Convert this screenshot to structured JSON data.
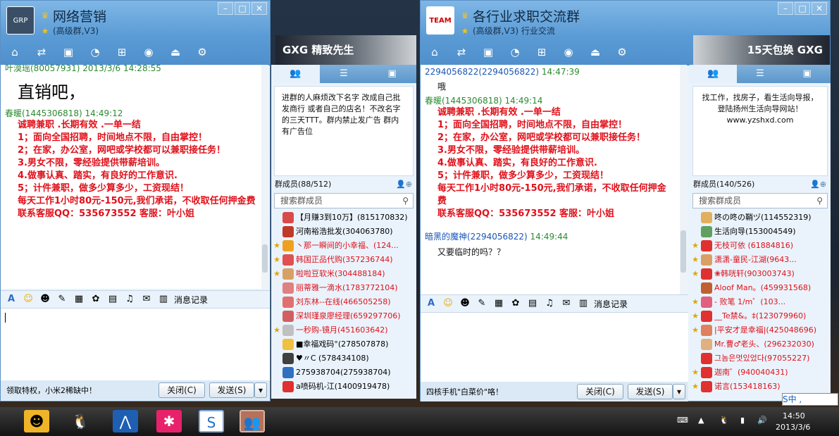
{
  "common": {
    "history": "消息记录",
    "close": "关闭(C)",
    "send": "发送(S)",
    "search": "搜索群成员"
  },
  "ime": "S中 ,",
  "win1": {
    "title": "网络营销",
    "subtitle": "(高级群,V3)",
    "banner": "GXG 精致先生",
    "tip": "领取特权，小米2稀缺中！",
    "notice": "进群的人麻烦改下名字 改成自己批发商行 或者自己的店名！不改名字的三天TTT。群内禁止发广告 群内有广告位",
    "members_label": "群成员(88/512)",
    "msgs": [
      {
        "sender": "叶漠瑶(80057931)",
        "time": "2013/3/6 14:28:55",
        "text": "直销吧，"
      },
      {
        "sender": "春暖(1445306818)",
        "time": "14:49:12",
        "text": ""
      }
    ],
    "ad_lines": [
      "诚聘兼职 .长期有效 .一单一结",
      "1；面向全国招聘，时间地点不限，自由掌控！",
      "2；在家，办公室，网吧或学校都可以兼职接任务！",
      "3.男女不限，零经验提供带薪培训。",
      "4.做事认真、踏实，有良好的工作意识.",
      "5；计件兼职，做多少算多少，工资现结！",
      "每天工作1小时80元-150元,我们承诺，不收取任何押金费",
      "联系客服QQ：535673552  客服：叶小姐"
    ],
    "members": [
      {
        "name": "【月赚3到10万】(815170832)",
        "red": false,
        "crown": false,
        "color": "#d94a4a"
      },
      {
        "name": "河南裕浩批发(304063780)",
        "red": false,
        "crown": false,
        "color": "#c0392b"
      },
      {
        "name": "丶那一瞬间的小幸福、(124...",
        "red": true,
        "crown": true,
        "color": "#f0a020"
      },
      {
        "name": "韩国正品代购(357236744)",
        "red": true,
        "crown": true,
        "color": "#e05050"
      },
      {
        "name": "啦啦豆软米(304488184)",
        "red": true,
        "crown": true,
        "color": "#d9a066"
      },
      {
        "name": "丽蒂雅一滴水(1783772104)",
        "red": true,
        "crown": false,
        "color": "#e08080"
      },
      {
        "name": "刘东林--在线(466505258)",
        "red": true,
        "crown": false,
        "color": "#e07070"
      },
      {
        "name": "深圳瑾泉廖经理(659297706)",
        "red": true,
        "crown": false,
        "color": "#d06060"
      },
      {
        "name": "一秒购-镜月(451603642)",
        "red": true,
        "crown": true,
        "color": "#c0c0c0"
      },
      {
        "name": "■幸福戏码°(278507878)",
        "red": false,
        "crown": false,
        "color": "#f0c040"
      },
      {
        "name": "♥〃C (578434108)",
        "red": false,
        "crown": false,
        "color": "#404040"
      },
      {
        "name": "275938704(275938704)",
        "red": false,
        "crown": false,
        "color": "#3070c0"
      },
      {
        "name": "a喷码机-江(1400919478)",
        "red": false,
        "crown": false,
        "color": "#e03030"
      }
    ]
  },
  "win2": {
    "title": "各行业求职交流群",
    "subtitle": "(高级群,V3) 行业交流",
    "banner": "15天包换 GXG",
    "tip": "四核手机\"白菜价\"咯！",
    "notice": "找工作，找房子，看生活向导报，登陆扬州生活向导网站！ www.yzshxd.com",
    "members_label": "群成员(140/526)",
    "msgs": [
      {
        "sender": "2294056822(2294056822)",
        "time": "14:47:39",
        "text": "哦"
      },
      {
        "sender": "春暖(1445306818)",
        "time": "14:49:14",
        "text": ""
      },
      {
        "sender": "暗黑的魔神(2294056822)",
        "time": "14:49:44",
        "text": "又要临时的吗？？"
      }
    ],
    "ad_lines": [
      "诚聘兼职 .长期有效 .一单一结",
      "1；面向全国招聘，时间地点不限，自由掌控！",
      "2；在家，办公室，网吧或学校都可以兼职接任务！",
      "3.男女不限，零经验提供带薪培训。",
      "4.做事认真、踏实，有良好的工作意识.",
      "5；计件兼职，做多少算多少，工资现结！",
      "每天工作1小时80元-150元,我们承诺，不收取任何押金费",
      "联系客服QQ：535673552  客服：叶小姐"
    ],
    "members": [
      {
        "name": "咚の咚の鞘ヅ(114552319)",
        "red": false,
        "crown": false,
        "color": "#e0b060"
      },
      {
        "name": "生活向导(153004549)",
        "red": false,
        "crown": false,
        "color": "#60a060"
      },
      {
        "name": "无枝可依 (61884816)",
        "red": true,
        "crown": true,
        "color": "#e03030"
      },
      {
        "name": "潇潇-童民-江湖(9643...",
        "red": true,
        "crown": true,
        "color": "#d9a066"
      },
      {
        "name": "❀韩咣轩(903003743)",
        "red": true,
        "crown": true,
        "color": "#e03030"
      },
      {
        "name": "Aloof Man。(459931568)",
        "red": true,
        "crown": false,
        "color": "#c06030"
      },
      {
        "name": "- 败笔     1/m゜(103...",
        "red": true,
        "crown": true,
        "color": "#e06080"
      },
      {
        "name": "__Te禁&。‡(123079960)",
        "red": true,
        "crown": true,
        "color": "#e03030"
      },
      {
        "name": "|平安才是幸福|(425048696)",
        "red": true,
        "crown": true,
        "color": "#e08060"
      },
      {
        "name": "Mr.曹♂老头、(296232030)",
        "red": true,
        "crown": false,
        "color": "#e0b080"
      },
      {
        "name": "그놈은멋있었다(97055227)",
        "red": true,
        "crown": false,
        "color": "#e03030"
      },
      {
        "name": "迦南゜(940040431)",
        "red": true,
        "crown": true,
        "color": "#e03030"
      },
      {
        "name": "诺言(153418163)",
        "red": true,
        "crown": true,
        "color": "#e03030"
      }
    ]
  },
  "taskbar": {
    "time": "14:50",
    "date": "2013/3/6"
  }
}
